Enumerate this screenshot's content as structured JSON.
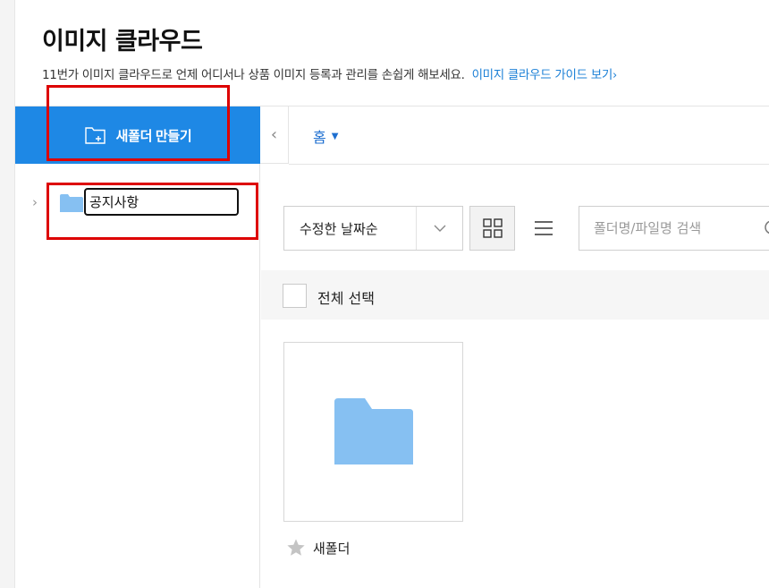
{
  "page": {
    "title": "이미지 클라우드",
    "subtitle": "11번가 이미지 클라우드로 언제 어디서나 상품 이미지 등록과 관리를 손쉽게 해보세요.",
    "guide_link": "이미지 클라우드 가이드 보기",
    "guide_link_chevron": "›"
  },
  "sidebar": {
    "new_folder_label": "새폴더 만들기",
    "tree": [
      {
        "name_value": "공지사항",
        "expanded": false
      }
    ]
  },
  "content": {
    "collapse_glyph": "‹",
    "breadcrumb": "홈",
    "breadcrumb_caret": "▼",
    "sort": {
      "selected": "수정한 날짜순"
    },
    "search": {
      "placeholder": "폴더명/파일명 검색",
      "value": ""
    },
    "select_all_label": "전체 선택",
    "folders": [
      {
        "name": "새폴더",
        "starred": false
      }
    ]
  },
  "colors": {
    "accent": "#1e88e5",
    "folder": "#86c0f2",
    "link": "#1a7fd6",
    "highlight": "#dd0000"
  }
}
